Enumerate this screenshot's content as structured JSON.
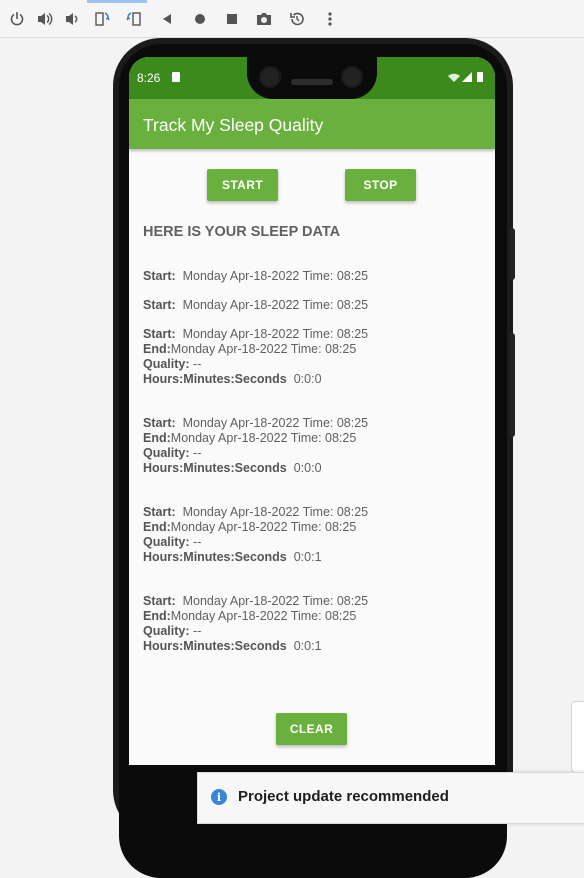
{
  "toolbar": {
    "icons": [
      "power-icon",
      "volume-up-icon",
      "volume-down-icon",
      "rotate-left-icon",
      "rotate-right-icon",
      "back-icon",
      "home-icon",
      "overview-icon",
      "camera-icon",
      "snapshot-restore-icon",
      "more-icon"
    ]
  },
  "status": {
    "time": "8:26"
  },
  "app": {
    "title": "Track My Sleep Quality"
  },
  "buttons": {
    "start": "START",
    "stop": "STOP",
    "clear": "CLEAR"
  },
  "heading": "HERE IS YOUR SLEEP DATA",
  "labels": {
    "start": "Start:",
    "end": "End:",
    "quality": "Quality:",
    "duration": "Hours:Minutes:Seconds"
  },
  "entries": [
    {
      "start": "Monday Apr-18-2022 Time: 08:25"
    },
    {
      "start": "Monday Apr-18-2022 Time: 08:25"
    },
    {
      "start": "Monday Apr-18-2022 Time: 08:25",
      "end": "Monday Apr-18-2022 Time: 08:25",
      "quality": "--",
      "duration": "0:0:0"
    },
    {
      "start": "Monday Apr-18-2022 Time: 08:25",
      "end": "Monday Apr-18-2022 Time: 08:25",
      "quality": "--",
      "duration": "0:0:0"
    },
    {
      "start": "Monday Apr-18-2022 Time: 08:25",
      "end": "Monday Apr-18-2022 Time: 08:25",
      "quality": "--",
      "duration": "0:0:1"
    },
    {
      "start": "Monday Apr-18-2022 Time: 08:25",
      "end": "Monday Apr-18-2022 Time: 08:25",
      "quality": "--",
      "duration": "0:0:1"
    }
  ],
  "notification": {
    "text": "Project update recommended"
  },
  "colors": {
    "primary": "#6ab03e",
    "primary_dark": "#3c8a1c"
  }
}
